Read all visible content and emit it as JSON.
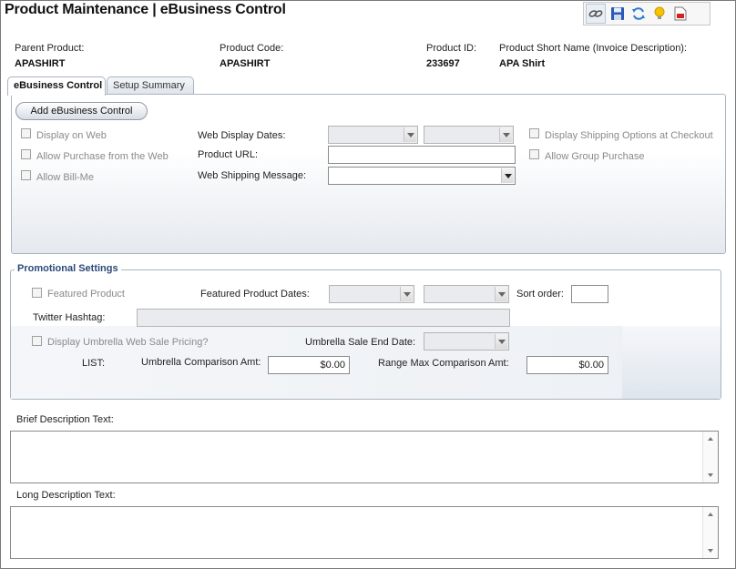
{
  "header": {
    "title": "Product Maintenance  |  eBusiness Control",
    "toolbar": [
      {
        "name": "link-icon"
      },
      {
        "name": "save-icon"
      },
      {
        "name": "refresh-icon"
      },
      {
        "name": "lightbulb-icon"
      },
      {
        "name": "pdf-report-icon"
      }
    ]
  },
  "product_info": {
    "parent_product_label": "Parent Product:",
    "parent_product_value": "APASHIRT",
    "product_code_label": "Product Code:",
    "product_code_value": "APASHIRT",
    "product_id_label": "Product ID:",
    "product_id_value": "233697",
    "short_name_label": "Product Short Name (Invoice Description):",
    "short_name_value": "APA Shirt"
  },
  "tabs": [
    {
      "label": "eBusiness Control",
      "active": true
    },
    {
      "label": "Setup Summary",
      "active": false
    }
  ],
  "ebusiness": {
    "add_button_label": "Add eBusiness Control",
    "display_on_web": "Display on Web",
    "allow_purchase_web": "Allow Purchase from the Web",
    "allow_bill_me": "Allow Bill-Me",
    "web_display_dates_label": "Web Display Dates:",
    "product_url_label": "Product URL:",
    "web_shipping_message_label": "Web Shipping Message:",
    "display_shipping_options": "Display Shipping Options at Checkout",
    "allow_group_purchase": "Allow Group Purchase"
  },
  "promotional": {
    "legend": "Promotional Settings",
    "featured_product": "Featured Product",
    "featured_product_dates_label": "Featured Product Dates:",
    "sort_order_label": "Sort order:",
    "twitter_hashtag_label": "Twitter Hashtag:",
    "display_umbrella_pricing": "Display Umbrella Web Sale Pricing?",
    "umbrella_end_date_label": "Umbrella Sale End Date:",
    "list_label": "LIST:",
    "umbrella_comparison_label": "Umbrella Comparison Amt:",
    "umbrella_comparison_value": "$0.00",
    "range_max_label": "Range Max Comparison Amt:",
    "range_max_value": "$0.00"
  },
  "descriptions": {
    "brief_label": "Brief Description Text:",
    "long_label": "Long Description Text:"
  }
}
